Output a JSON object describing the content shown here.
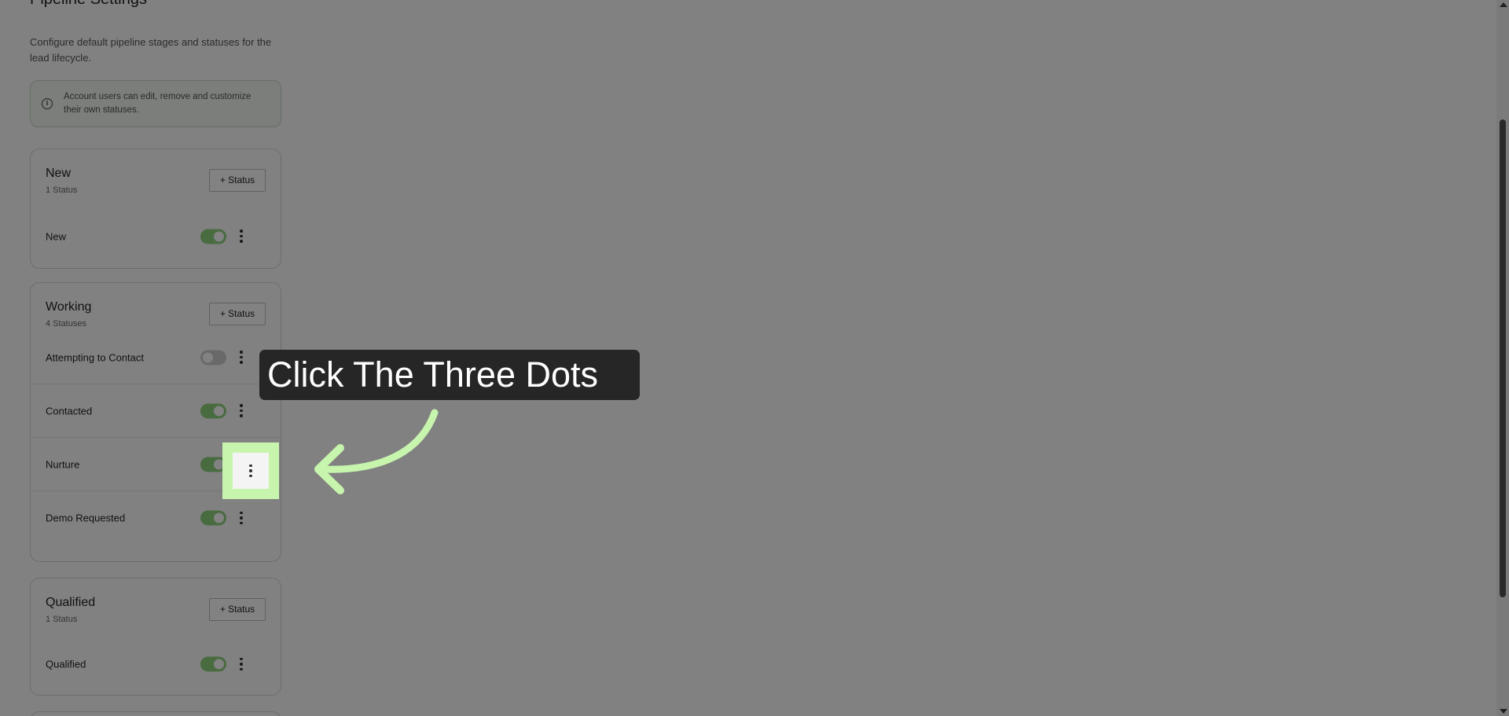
{
  "header": {
    "title_fragment": "Pipeline Settings",
    "description": "Configure default pipeline stages and statuses for the lead lifecycle.",
    "info": "Account users can edit, remove and customize their own statuses."
  },
  "add_status_label": "+ Status",
  "stages": [
    {
      "name": "New",
      "count": "1 Status",
      "statuses": [
        {
          "label": "New",
          "enabled": true
        }
      ]
    },
    {
      "name": "Working",
      "count": "4 Statuses",
      "statuses": [
        {
          "label": "Attempting to Contact",
          "enabled": false
        },
        {
          "label": "Contacted",
          "enabled": true
        },
        {
          "label": "Nurture",
          "enabled": true
        },
        {
          "label": "Demo Requested",
          "enabled": true
        }
      ]
    },
    {
      "name": "Qualified",
      "count": "1 Status",
      "statuses": [
        {
          "label": "Qualified",
          "enabled": true
        }
      ]
    }
  ],
  "callout": {
    "text": "Click The Three Dots"
  },
  "colors": {
    "highlight": "#c7f5ad",
    "toggle_on": "#8fd27f",
    "callout_bg": "#262626"
  }
}
